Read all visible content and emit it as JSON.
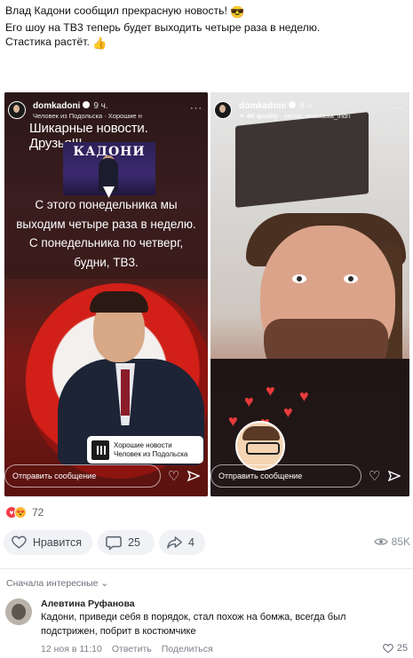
{
  "post": {
    "line1": "Влад Кадони сообщил прекрасную новость!",
    "line2": "Его шоу на ТВ3 теперь будет выходить четыре раза в неделю.",
    "line3": "Стастика растёт."
  },
  "stories": [
    {
      "author": "domkadoni",
      "time": "9 ч.",
      "subtitle": "Человек из Подольска · Хорошие н",
      "headline": "Шикарные новости. Друзья!!!",
      "poster_title": "КАДОНИ",
      "announcement": [
        "С этого понедельника мы",
        "выходим четыре раза в неделю.",
        "С понедельника по четверг,",
        "будни, ТВ3."
      ],
      "music": {
        "title": "Хорошие новости",
        "artist": "Человек из Подольска"
      },
      "reply_placeholder": "Отправить сообщение"
    },
    {
      "author": "domkadoni",
      "time": "8 ч.",
      "subtitle": "4K quality",
      "subtitle_author": "· автор: anastasia_indri",
      "reply_placeholder": "Отправить сообщение"
    }
  ],
  "reactions": {
    "count": "72"
  },
  "actions": {
    "like_label": "Нравится",
    "comments_count": "25",
    "shares_count": "4",
    "views": "85K"
  },
  "comments_sort": "Сначала интересные",
  "comment": {
    "author": "Алевтина Руфанова",
    "text_line1": "Кадони, приведи себя в порядок, стал похож на бомжа, всегда был",
    "text_line2": "подстрижен, побрит в костюмчике",
    "date": "12 ноя в 11:10",
    "reply": "Ответить",
    "share": "Поделиться",
    "likes": "25"
  },
  "colors": {
    "accent": "#2688eb",
    "like_red": "#f03c4c"
  }
}
